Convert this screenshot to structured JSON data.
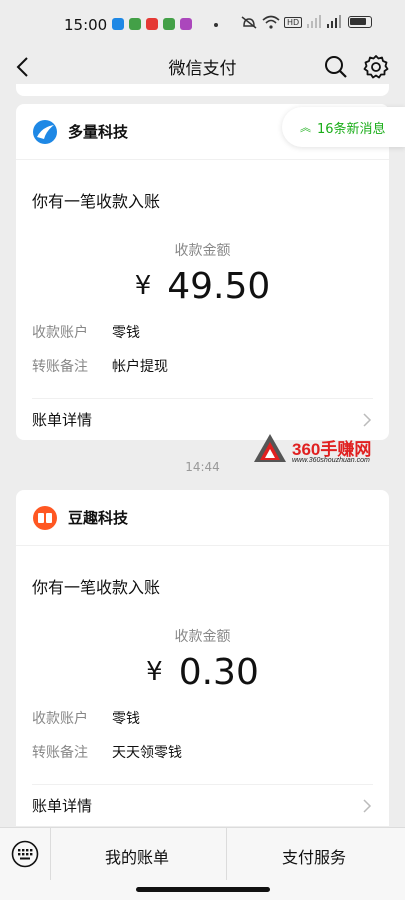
{
  "status_bar": {
    "time": "15:00",
    "hd_label": "HD",
    "app_icon_colors": [
      "#1e88e5",
      "#43a047",
      "#e53935",
      "#43a047",
      "#ab47bc"
    ]
  },
  "nav": {
    "title": "微信支付",
    "back_icon": "chevron-left-icon",
    "search_icon": "search-icon",
    "settings_icon": "gear-icon"
  },
  "new_messages": {
    "label": "16条新消息",
    "icon": "double-chevron-up-icon",
    "color": "#1aad19"
  },
  "cards": [
    {
      "brand": "多量科技",
      "intro": "你有一笔收款入账",
      "amount_label": "收款金额",
      "currency": "¥",
      "amount": "49.50",
      "fields": [
        {
          "label": "收款账户",
          "value": "零钱"
        },
        {
          "label": "转账备注",
          "value": "帐户提现"
        }
      ],
      "detail_label": "账单详情"
    },
    {
      "brand": "豆趣科技",
      "intro": "你有一笔收款入账",
      "amount_label": "收款金额",
      "currency": "¥",
      "amount": "0.30",
      "fields": [
        {
          "label": "收款账户",
          "value": "零钱"
        },
        {
          "label": "转账备注",
          "value": "天天领零钱"
        }
      ],
      "detail_label": "账单详情"
    }
  ],
  "timestamp": "14:44",
  "watermark": {
    "name": "360手赚网",
    "url": "www.360shouzhuan.com"
  },
  "bottom_bar": {
    "keyboard_icon": "keyboard-icon",
    "items": [
      "我的账单",
      "支付服务"
    ]
  }
}
